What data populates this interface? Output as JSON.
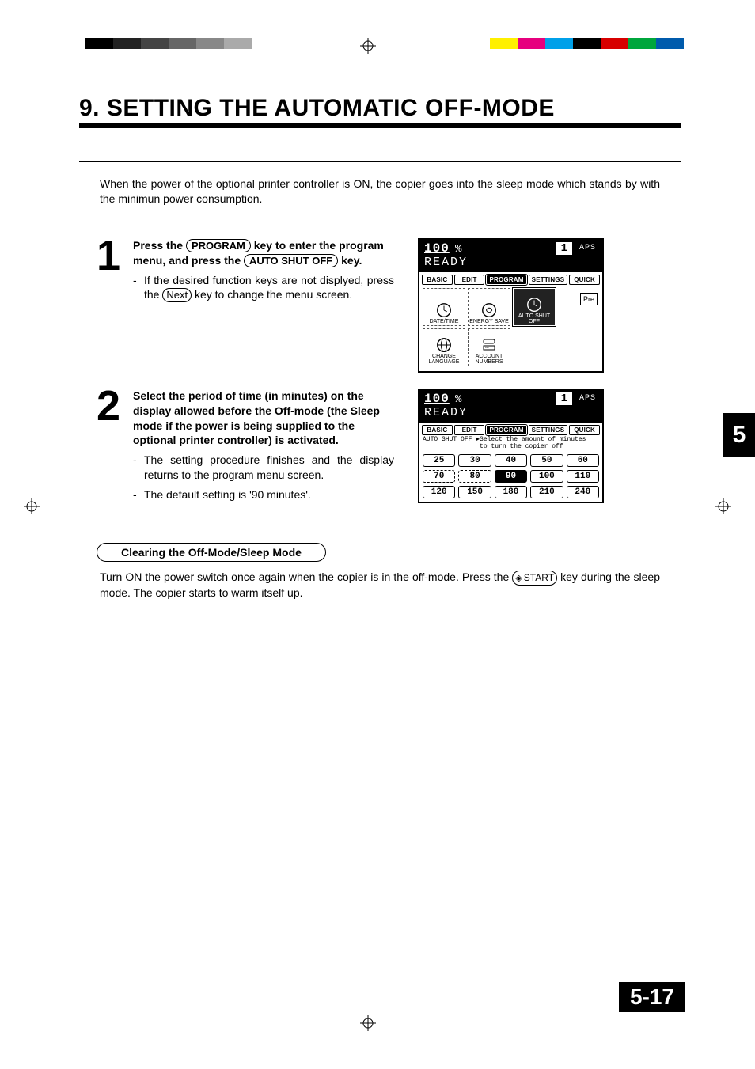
{
  "title": "9. SETTING THE AUTOMATIC OFF-MODE",
  "intro": "When the power of the optional printer controller is ON, the copier goes into the sleep mode which stands by with the minimun power consumption.",
  "chapter_tab": "5",
  "page_number": "5-17",
  "keys": {
    "program": "PROGRAM",
    "auto_shut_off": "AUTO SHUT OFF",
    "next": "Next",
    "start": "START"
  },
  "step1": {
    "num": "1",
    "line_a": "Press the ",
    "line_b": " key to enter the program menu, and  press the ",
    "line_c": " key.",
    "bullet_a": "If the desired function keys are not displyed, press the ",
    "bullet_b": " key to change the menu screen."
  },
  "step2": {
    "num": "2",
    "bold": "Select the period of time (in minutes) on the display allowed before the Off-mode (the Sleep mode if the power is being supplied to the optional printer controller) is activated.",
    "b1": "The setting procedure finishes and the display returns to the program menu screen.",
    "b2": "The default setting is '90 minutes'."
  },
  "pill": "Clearing the Off-Mode/Sleep Mode",
  "clearing_a": "Turn ON the power switch once again when the copier is in the off-mode.  Press the ",
  "clearing_b": " key during the sleep mode.  The copier starts to warm itself up.",
  "screen_common": {
    "zoom": "100",
    "pct": "%",
    "num": "1",
    "aps": "APS",
    "ready": "READY",
    "tabs": [
      "BASIC",
      "EDIT",
      "PROGRAM",
      "SETTINGS",
      "QUICK"
    ]
  },
  "screen1": {
    "icons": [
      "DATE/TIME",
      "ENERGY SAVE",
      "AUTO SHUT OFF",
      "CHANGE LANGUAGE",
      "ACCOUNT NUMBERS"
    ],
    "pre": "Pre"
  },
  "screen2": {
    "instr1": "AUTO SHUT OFF ▶Select the amount of minutes",
    "instr2": "to turn the copier off",
    "values": [
      "25",
      "30",
      "40",
      "50",
      "60",
      "70",
      "80",
      "90",
      "100",
      "110",
      "120",
      "150",
      "180",
      "210",
      "240"
    ],
    "selected": "90"
  }
}
